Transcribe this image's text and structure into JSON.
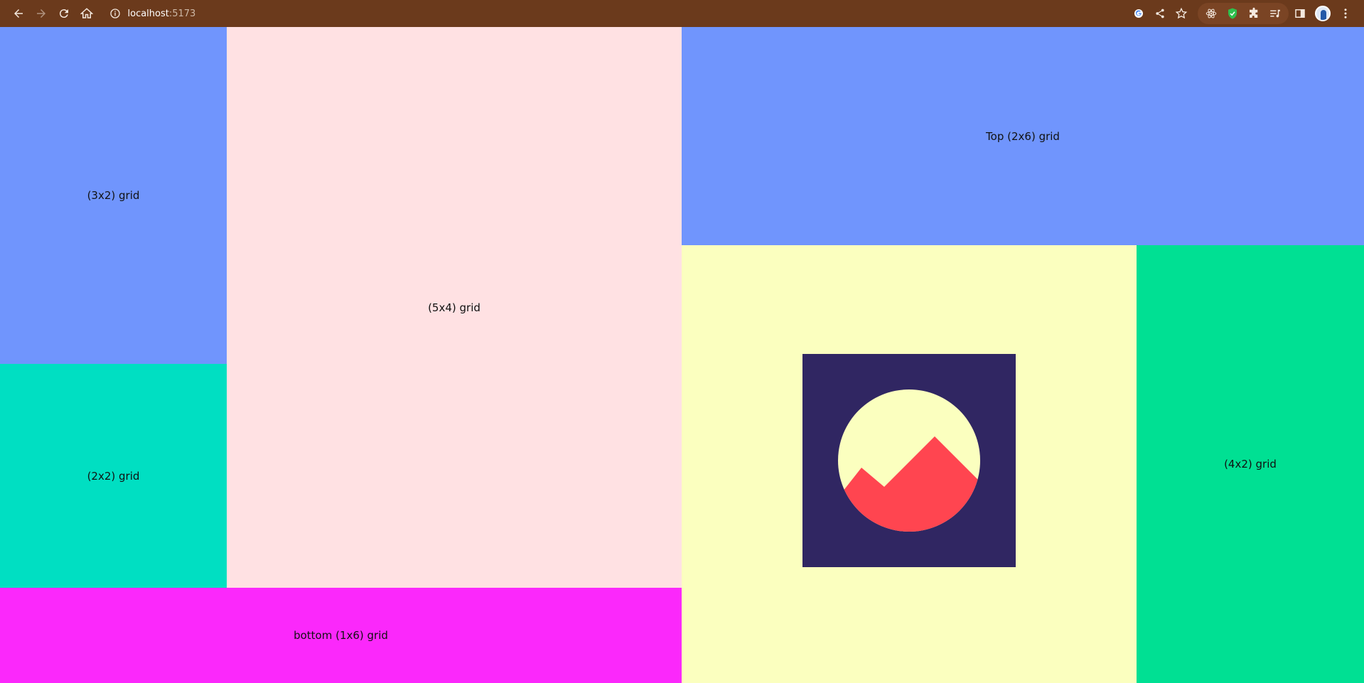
{
  "browser": {
    "url_host": "localhost",
    "url_port": ":5173",
    "chrome_color": "#6b3a1c"
  },
  "grid": {
    "cells": {
      "left_top": {
        "label": "(3x2) grid",
        "color": "#7095fd"
      },
      "left_mid": {
        "label": "(2x2) grid",
        "color": "#00dfc2"
      },
      "center": {
        "label": "(5x4) grid",
        "color": "#ffe1e3"
      },
      "bottom": {
        "label": "bottom (1x6) grid",
        "color": "#fb28fb"
      },
      "top_right": {
        "label": "Top (2x6) grid",
        "color": "#7095fd"
      },
      "logo_cell": {
        "label": "",
        "color": "#fbffbf"
      },
      "right": {
        "label": "(4x2) grid",
        "color": "#00e093"
      }
    }
  },
  "logo": {
    "icon": "mountain-sun-logo",
    "background_color": "#302662",
    "circle_color": "#fbffbf",
    "mountain_color": "#ff4550"
  }
}
